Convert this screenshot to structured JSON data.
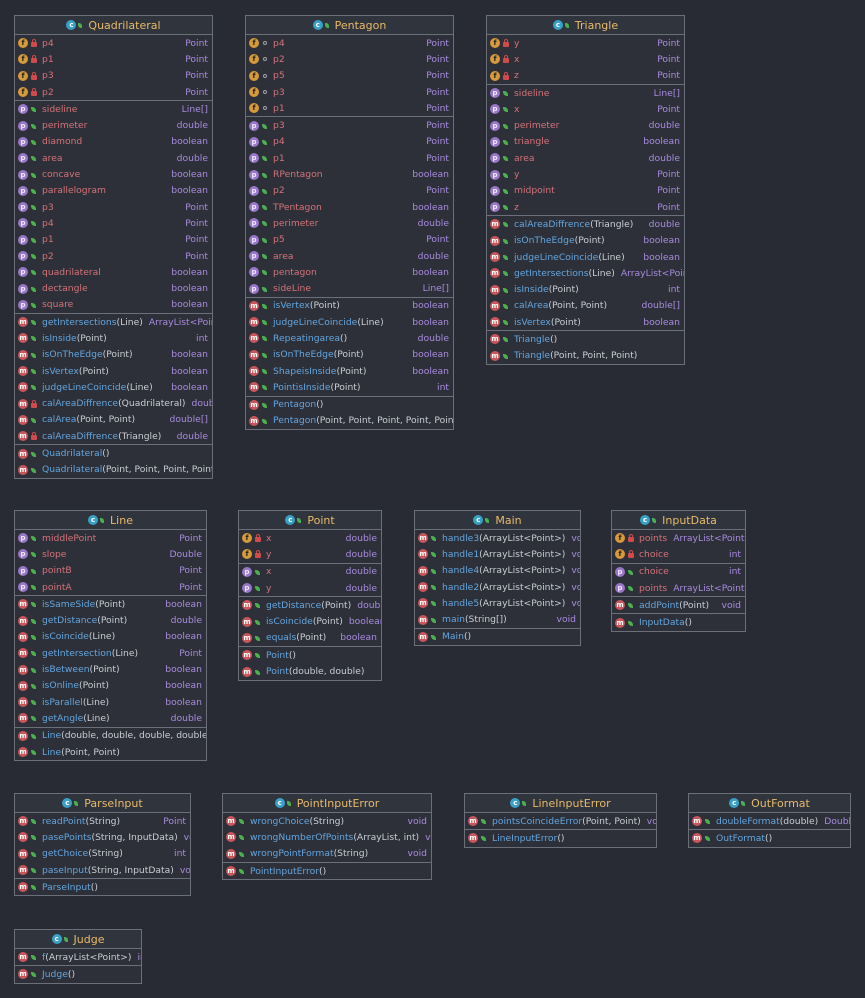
{
  "classes": [
    {
      "name": "Quadrilateral",
      "sections": [
        [
          {
            "k": "f",
            "v": "priv",
            "n": "p4",
            "t": "Point"
          },
          {
            "k": "f",
            "v": "priv",
            "n": "p1",
            "t": "Point"
          },
          {
            "k": "f",
            "v": "priv",
            "n": "p3",
            "t": "Point"
          },
          {
            "k": "f",
            "v": "priv",
            "n": "p2",
            "t": "Point"
          }
        ],
        [
          {
            "k": "p",
            "v": "pub",
            "n": "sideline",
            "t": "Line[]"
          },
          {
            "k": "p",
            "v": "pub",
            "n": "perimeter",
            "t": "double"
          },
          {
            "k": "p",
            "v": "pub",
            "n": "diamond",
            "t": "boolean"
          },
          {
            "k": "p",
            "v": "pub",
            "n": "area",
            "t": "double"
          },
          {
            "k": "p",
            "v": "pub",
            "n": "concave",
            "t": "boolean"
          },
          {
            "k": "p",
            "v": "pub",
            "n": "parallelogram",
            "t": "boolean"
          },
          {
            "k": "p",
            "v": "pub",
            "n": "p3",
            "t": "Point"
          },
          {
            "k": "p",
            "v": "pub",
            "n": "p4",
            "t": "Point"
          },
          {
            "k": "p",
            "v": "pub",
            "n": "p1",
            "t": "Point"
          },
          {
            "k": "p",
            "v": "pub",
            "n": "p2",
            "t": "Point"
          },
          {
            "k": "p",
            "v": "pub",
            "n": "quadrilateral",
            "t": "boolean"
          },
          {
            "k": "p",
            "v": "pub",
            "n": "dectangle",
            "t": "boolean"
          },
          {
            "k": "p",
            "v": "pub",
            "n": "square",
            "t": "boolean"
          }
        ],
        [
          {
            "k": "m",
            "v": "pub",
            "n": "getIntersections",
            "a": "(Line)",
            "t": "ArrayList<Point>"
          },
          {
            "k": "m",
            "v": "pub",
            "n": "isInside",
            "a": "(Point)",
            "t": "int"
          },
          {
            "k": "m",
            "v": "pub",
            "n": "isOnTheEdge",
            "a": "(Point)",
            "t": "boolean"
          },
          {
            "k": "m",
            "v": "pub",
            "n": "isVertex",
            "a": "(Point)",
            "t": "boolean"
          },
          {
            "k": "m",
            "v": "pub",
            "n": "judgeLineCoincide",
            "a": "(Line)",
            "t": "boolean"
          },
          {
            "k": "m",
            "v": "priv",
            "n": "calAreaDiffrence",
            "a": "(Quadrilateral)",
            "t": "double"
          },
          {
            "k": "m",
            "v": "pub",
            "n": "calArea",
            "a": "(Point, Point)",
            "t": "double[]"
          },
          {
            "k": "m",
            "v": "priv",
            "n": "calAreaDiffrence",
            "a": "(Triangle)",
            "t": "double"
          }
        ],
        [
          {
            "k": "m",
            "v": "pub",
            "n": "Quadrilateral",
            "a": "()",
            "t": ""
          },
          {
            "k": "m",
            "v": "pub",
            "n": "Quadrilateral",
            "a": "(Point, Point, Point, Point)",
            "t": ""
          }
        ]
      ]
    },
    {
      "name": "Pentagon",
      "sections": [
        [
          {
            "k": "f",
            "v": "pkg",
            "n": "p4",
            "t": "Point"
          },
          {
            "k": "f",
            "v": "pkg",
            "n": "p2",
            "t": "Point"
          },
          {
            "k": "f",
            "v": "pkg",
            "n": "p5",
            "t": "Point"
          },
          {
            "k": "f",
            "v": "pkg",
            "n": "p3",
            "t": "Point"
          },
          {
            "k": "f",
            "v": "pkg",
            "n": "p1",
            "t": "Point"
          }
        ],
        [
          {
            "k": "p",
            "v": "pub",
            "n": "p3",
            "t": "Point"
          },
          {
            "k": "p",
            "v": "pub",
            "n": "p4",
            "t": "Point"
          },
          {
            "k": "p",
            "v": "pub",
            "n": "p1",
            "t": "Point"
          },
          {
            "k": "p",
            "v": "pub",
            "n": "RPentagon",
            "t": "boolean"
          },
          {
            "k": "p",
            "v": "pub",
            "n": "p2",
            "t": "Point"
          },
          {
            "k": "p",
            "v": "pub",
            "n": "TPentagon",
            "t": "boolean"
          },
          {
            "k": "p",
            "v": "pub",
            "n": "perimeter",
            "t": "double"
          },
          {
            "k": "p",
            "v": "pub",
            "n": "p5",
            "t": "Point"
          },
          {
            "k": "p",
            "v": "pub",
            "n": "area",
            "t": "double"
          },
          {
            "k": "p",
            "v": "pub",
            "n": "pentagon",
            "t": "boolean"
          },
          {
            "k": "p",
            "v": "pub",
            "n": "sideLine",
            "t": "Line[]"
          }
        ],
        [
          {
            "k": "m",
            "v": "pub",
            "n": "isVertex",
            "a": "(Point)",
            "t": "boolean"
          },
          {
            "k": "m",
            "v": "pub",
            "n": "judgeLineCoincide",
            "a": "(Line)",
            "t": "boolean"
          },
          {
            "k": "m",
            "v": "pub",
            "n": "Repeatingarea",
            "a": "()",
            "t": "double"
          },
          {
            "k": "m",
            "v": "pub",
            "n": "isOnTheEdge",
            "a": "(Point)",
            "t": "boolean"
          },
          {
            "k": "m",
            "v": "pub",
            "n": "ShapeisInside",
            "a": "(Point)",
            "t": "boolean"
          },
          {
            "k": "m",
            "v": "pub",
            "n": "PointisInside",
            "a": "(Point)",
            "t": "int"
          }
        ],
        [
          {
            "k": "m",
            "v": "pub",
            "n": "Pentagon",
            "a": "()",
            "t": ""
          },
          {
            "k": "m",
            "v": "pub",
            "n": "Pentagon",
            "a": "(Point, Point, Point, Point, Point)",
            "t": ""
          }
        ]
      ]
    },
    {
      "name": "Triangle",
      "sections": [
        [
          {
            "k": "f",
            "v": "priv",
            "n": "y",
            "t": "Point"
          },
          {
            "k": "f",
            "v": "priv",
            "n": "x",
            "t": "Point"
          },
          {
            "k": "f",
            "v": "priv",
            "n": "z",
            "t": "Point"
          }
        ],
        [
          {
            "k": "p",
            "v": "pub",
            "n": "sideline",
            "t": "Line[]"
          },
          {
            "k": "p",
            "v": "pub",
            "n": "x",
            "t": "Point"
          },
          {
            "k": "p",
            "v": "pub",
            "n": "perimeter",
            "t": "double"
          },
          {
            "k": "p",
            "v": "pub",
            "n": "triangle",
            "t": "boolean"
          },
          {
            "k": "p",
            "v": "pub",
            "n": "area",
            "t": "double"
          },
          {
            "k": "p",
            "v": "pub",
            "n": "y",
            "t": "Point"
          },
          {
            "k": "p",
            "v": "pub",
            "n": "midpoint",
            "t": "Point"
          },
          {
            "k": "p",
            "v": "pub",
            "n": "z",
            "t": "Point"
          }
        ],
        [
          {
            "k": "m",
            "v": "pub",
            "n": "calAreaDiffrence",
            "a": "(Triangle)",
            "t": "double"
          },
          {
            "k": "m",
            "v": "pub",
            "n": "isOnTheEdge",
            "a": "(Point)",
            "t": "boolean"
          },
          {
            "k": "m",
            "v": "pub",
            "n": "judgeLineCoincide",
            "a": "(Line)",
            "t": "boolean"
          },
          {
            "k": "m",
            "v": "pub",
            "n": "getIntersections",
            "a": "(Line)",
            "t": "ArrayList<Point>"
          },
          {
            "k": "m",
            "v": "pub",
            "n": "isInside",
            "a": "(Point)",
            "t": "int"
          },
          {
            "k": "m",
            "v": "pub",
            "n": "calArea",
            "a": "(Point, Point)",
            "t": "double[]"
          },
          {
            "k": "m",
            "v": "pub",
            "n": "isVertex",
            "a": "(Point)",
            "t": "boolean"
          }
        ],
        [
          {
            "k": "m",
            "v": "pub",
            "n": "Triangle",
            "a": "()",
            "t": ""
          },
          {
            "k": "m",
            "v": "pub",
            "n": "Triangle",
            "a": "(Point, Point, Point)",
            "t": ""
          }
        ]
      ]
    },
    {
      "name": "Line",
      "sections": [
        [
          {
            "k": "p",
            "v": "pub",
            "n": "middlePoint",
            "t": "Point"
          },
          {
            "k": "p",
            "v": "pub",
            "n": "slope",
            "t": "Double"
          },
          {
            "k": "p",
            "v": "pub",
            "n": "pointB",
            "t": "Point"
          },
          {
            "k": "p",
            "v": "pub",
            "n": "pointA",
            "t": "Point"
          }
        ],
        [
          {
            "k": "m",
            "v": "pub",
            "n": "isSameSide",
            "a": "(Point)",
            "t": "boolean"
          },
          {
            "k": "m",
            "v": "pub",
            "n": "getDistance",
            "a": "(Point)",
            "t": "double"
          },
          {
            "k": "m",
            "v": "pub",
            "n": "isCoincide",
            "a": "(Line)",
            "t": "boolean"
          },
          {
            "k": "m",
            "v": "pub",
            "n": "getIntersection",
            "a": "(Line)",
            "t": "Point"
          },
          {
            "k": "m",
            "v": "pub",
            "n": "isBetween",
            "a": "(Point)",
            "t": "boolean"
          },
          {
            "k": "m",
            "v": "pub",
            "n": "isOnline",
            "a": "(Point)",
            "t": "boolean"
          },
          {
            "k": "m",
            "v": "pub",
            "n": "isParallel",
            "a": "(Line)",
            "t": "boolean"
          },
          {
            "k": "m",
            "v": "pub",
            "n": "getAngle",
            "a": "(Line)",
            "t": "double"
          }
        ],
        [
          {
            "k": "m",
            "v": "pub",
            "n": "Line",
            "a": "(double, double, double, double)",
            "t": ""
          },
          {
            "k": "m",
            "v": "pub",
            "n": "Line",
            "a": "(Point, Point)",
            "t": ""
          }
        ]
      ]
    },
    {
      "name": "Point",
      "sections": [
        [
          {
            "k": "f",
            "v": "priv",
            "n": "x",
            "t": "double"
          },
          {
            "k": "f",
            "v": "priv",
            "n": "y",
            "t": "double"
          }
        ],
        [
          {
            "k": "p",
            "v": "pub",
            "n": "x",
            "t": "double"
          },
          {
            "k": "p",
            "v": "pub",
            "n": "y",
            "t": "double"
          }
        ],
        [
          {
            "k": "m",
            "v": "pub",
            "n": "getDistance",
            "a": "(Point)",
            "t": "double"
          },
          {
            "k": "m",
            "v": "pub",
            "n": "isCoincide",
            "a": "(Point)",
            "t": "boolean"
          },
          {
            "k": "m",
            "v": "pub",
            "n": "equals",
            "a": "(Point)",
            "t": "boolean"
          }
        ],
        [
          {
            "k": "m",
            "v": "pub",
            "n": "Point",
            "a": "()",
            "t": ""
          },
          {
            "k": "m",
            "v": "pub",
            "n": "Point",
            "a": "(double, double)",
            "t": ""
          }
        ]
      ]
    },
    {
      "name": "Main",
      "sections": [
        [
          {
            "k": "m",
            "v": "pub",
            "n": "handle3",
            "a": "(ArrayList<Point>)",
            "t": "void"
          },
          {
            "k": "m",
            "v": "pub",
            "n": "handle1",
            "a": "(ArrayList<Point>)",
            "t": "void"
          },
          {
            "k": "m",
            "v": "pub",
            "n": "handle4",
            "a": "(ArrayList<Point>)",
            "t": "void"
          },
          {
            "k": "m",
            "v": "pub",
            "n": "handle2",
            "a": "(ArrayList<Point>)",
            "t": "void"
          },
          {
            "k": "m",
            "v": "pub",
            "n": "handle5",
            "a": "(ArrayList<Point>)",
            "t": "void"
          },
          {
            "k": "m",
            "v": "pub",
            "n": "main",
            "a": "(String[])",
            "t": "void"
          }
        ],
        [
          {
            "k": "m",
            "v": "pub",
            "n": "Main",
            "a": "()",
            "t": ""
          }
        ]
      ]
    },
    {
      "name": "InputData",
      "sections": [
        [
          {
            "k": "f",
            "v": "priv",
            "n": "points",
            "t": "ArrayList<Point>"
          },
          {
            "k": "f",
            "v": "priv",
            "n": "choice",
            "t": "int"
          }
        ],
        [
          {
            "k": "p",
            "v": "pub",
            "n": "choice",
            "t": "int"
          },
          {
            "k": "p",
            "v": "pub",
            "n": "points",
            "t": "ArrayList<Point>"
          }
        ],
        [
          {
            "k": "m",
            "v": "pub",
            "n": "addPoint",
            "a": "(Point)",
            "t": "void"
          }
        ],
        [
          {
            "k": "m",
            "v": "pub",
            "n": "InputData",
            "a": "()",
            "t": ""
          }
        ]
      ]
    },
    {
      "name": "ParseInput",
      "sections": [
        [
          {
            "k": "m",
            "v": "pub",
            "n": "readPoint",
            "a": "(String)",
            "t": "Point"
          },
          {
            "k": "m",
            "v": "pub",
            "n": "pasePoints",
            "a": "(String, InputData)",
            "t": "void"
          },
          {
            "k": "m",
            "v": "pub",
            "n": "getChoice",
            "a": "(String)",
            "t": "int"
          },
          {
            "k": "m",
            "v": "pub",
            "n": "paseInput",
            "a": "(String, InputData)",
            "t": "void"
          }
        ],
        [
          {
            "k": "m",
            "v": "pub",
            "n": "ParseInput",
            "a": "()",
            "t": ""
          }
        ]
      ]
    },
    {
      "name": "PointInputError",
      "sections": [
        [
          {
            "k": "m",
            "v": "pub",
            "n": "wrongChoice",
            "a": "(String)",
            "t": "void"
          },
          {
            "k": "m",
            "v": "pub",
            "n": "wrongNumberOfPoints",
            "a": "(ArrayList, int)",
            "t": "void"
          },
          {
            "k": "m",
            "v": "pub",
            "n": "wrongPointFormat",
            "a": "(String)",
            "t": "void"
          }
        ],
        [
          {
            "k": "m",
            "v": "pub",
            "n": "PointInputError",
            "a": "()",
            "t": ""
          }
        ]
      ]
    },
    {
      "name": "LineInputError",
      "sections": [
        [
          {
            "k": "m",
            "v": "pub",
            "n": "pointsCoincideError",
            "a": "(Point, Point)",
            "t": "void"
          }
        ],
        [
          {
            "k": "m",
            "v": "pub",
            "n": "LineInputError",
            "a": "()",
            "t": ""
          }
        ]
      ]
    },
    {
      "name": "OutFormat",
      "sections": [
        [
          {
            "k": "m",
            "v": "pub",
            "n": "doubleFormat",
            "a": "(double)",
            "t": "Double"
          }
        ],
        [
          {
            "k": "m",
            "v": "pub",
            "n": "OutFormat",
            "a": "()",
            "t": ""
          }
        ]
      ]
    },
    {
      "name": "Judge",
      "sections": [
        [
          {
            "k": "m",
            "v": "pub",
            "n": "f",
            "a": "(ArrayList<Point>)",
            "t": "int"
          }
        ],
        [
          {
            "k": "m",
            "v": "pub",
            "n": "Judge",
            "a": "()",
            "t": ""
          }
        ]
      ]
    }
  ]
}
